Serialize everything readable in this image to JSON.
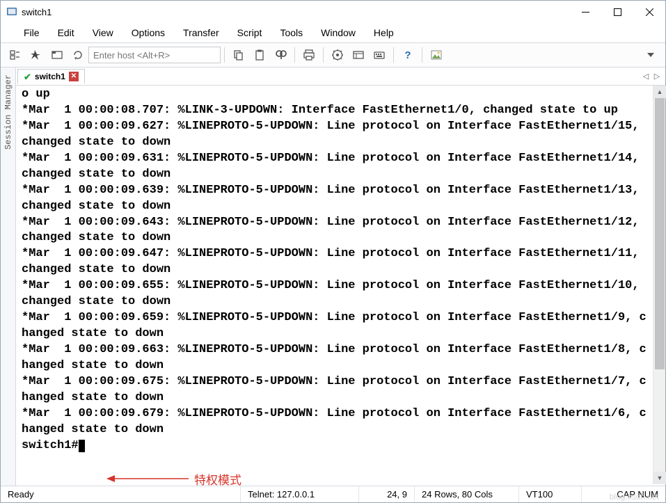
{
  "title": "switch1",
  "menu": [
    "File",
    "Edit",
    "View",
    "Options",
    "Transfer",
    "Script",
    "Tools",
    "Window",
    "Help"
  ],
  "toolbar": {
    "host_placeholder": "Enter host <Alt+R>"
  },
  "sidebar": {
    "label": "Session Manager"
  },
  "tab": {
    "name": "switch1"
  },
  "terminal_lines": [
    "o up",
    "*Mar  1 00:00:08.707: %LINK-3-UPDOWN: Interface FastEthernet1/0, changed state to up",
    "*Mar  1 00:00:09.627: %LINEPROTO-5-UPDOWN: Line protocol on Interface FastEthernet1/15, changed state to down",
    "*Mar  1 00:00:09.631: %LINEPROTO-5-UPDOWN: Line protocol on Interface FastEthernet1/14, changed state to down",
    "*Mar  1 00:00:09.639: %LINEPROTO-5-UPDOWN: Line protocol on Interface FastEthernet1/13, changed state to down",
    "*Mar  1 00:00:09.643: %LINEPROTO-5-UPDOWN: Line protocol on Interface FastEthernet1/12, changed state to down",
    "*Mar  1 00:00:09.647: %LINEPROTO-5-UPDOWN: Line protocol on Interface FastEthernet1/11, changed state to down",
    "*Mar  1 00:00:09.655: %LINEPROTO-5-UPDOWN: Line protocol on Interface FastEthernet1/10, changed state to down",
    "*Mar  1 00:00:09.659: %LINEPROTO-5-UPDOWN: Line protocol on Interface FastEthernet1/9, changed state to down",
    "*Mar  1 00:00:09.663: %LINEPROTO-5-UPDOWN: Line protocol on Interface FastEthernet1/8, changed state to down",
    "*Mar  1 00:00:09.675: %LINEPROTO-5-UPDOWN: Line protocol on Interface FastEthernet1/7, changed state to down",
    "*Mar  1 00:00:09.679: %LINEPROTO-5-UPDOWN: Line protocol on Interface FastEthernet1/6, changed state to down"
  ],
  "prompt": "switch1#",
  "annotation": "特权模式",
  "status": {
    "ready": "Ready",
    "conn": "Telnet: 127.0.0.1",
    "pos": "24,   9",
    "size": "24 Rows, 80 Cols",
    "emul": "VT100",
    "caps": "CAP  NUM"
  },
  "watermark": "blog.csdn.net"
}
